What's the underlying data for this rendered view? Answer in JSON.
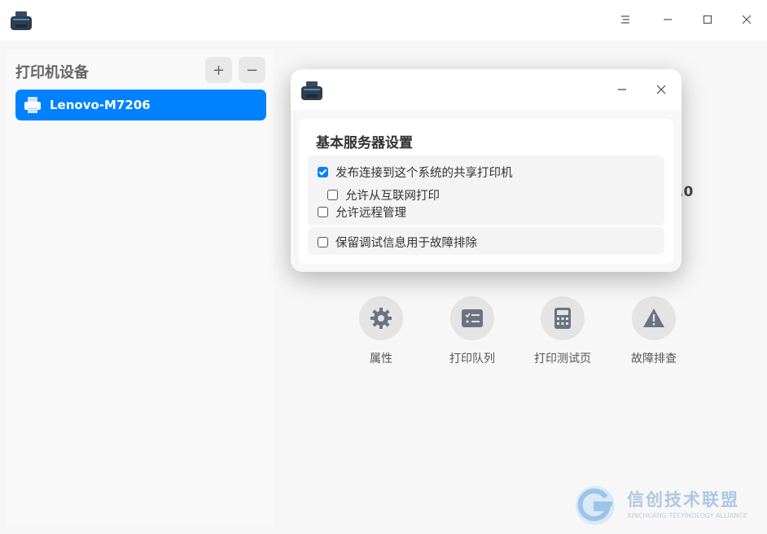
{
  "main_window": {
    "panel_title": "打印机设备",
    "add_label": "+",
    "remove_label": "−",
    "devices": [
      {
        "label": "Lenovo-M7206",
        "selected": true
      }
    ],
    "version_fragment": ".0",
    "actions": [
      {
        "label": "属性",
        "icon": "gear-icon"
      },
      {
        "label": "打印队列",
        "icon": "queue-list-icon"
      },
      {
        "label": "打印测试页",
        "icon": "test-page-icon"
      },
      {
        "label": "故障排查",
        "icon": "warning-icon"
      }
    ],
    "window_controls": [
      "menu-icon",
      "minimize-icon",
      "maximize-icon",
      "close-icon"
    ]
  },
  "dialog": {
    "heading": "基本服务器设置",
    "options": [
      {
        "label": "发布连接到这个系统的共享打印机",
        "checked": true
      },
      {
        "label": "允许从互联网打印",
        "checked": false
      },
      {
        "label": "允许远程管理",
        "checked": false
      },
      {
        "label": "保留调试信息用于故障排除",
        "checked": false
      }
    ]
  },
  "watermark": {
    "title": "信创技术联盟",
    "subtitle": "XINCHUANG TECHNOLOGY ALLIANCE"
  },
  "colors": {
    "accent": "#0081ff",
    "watermark": "#aec8e4"
  }
}
